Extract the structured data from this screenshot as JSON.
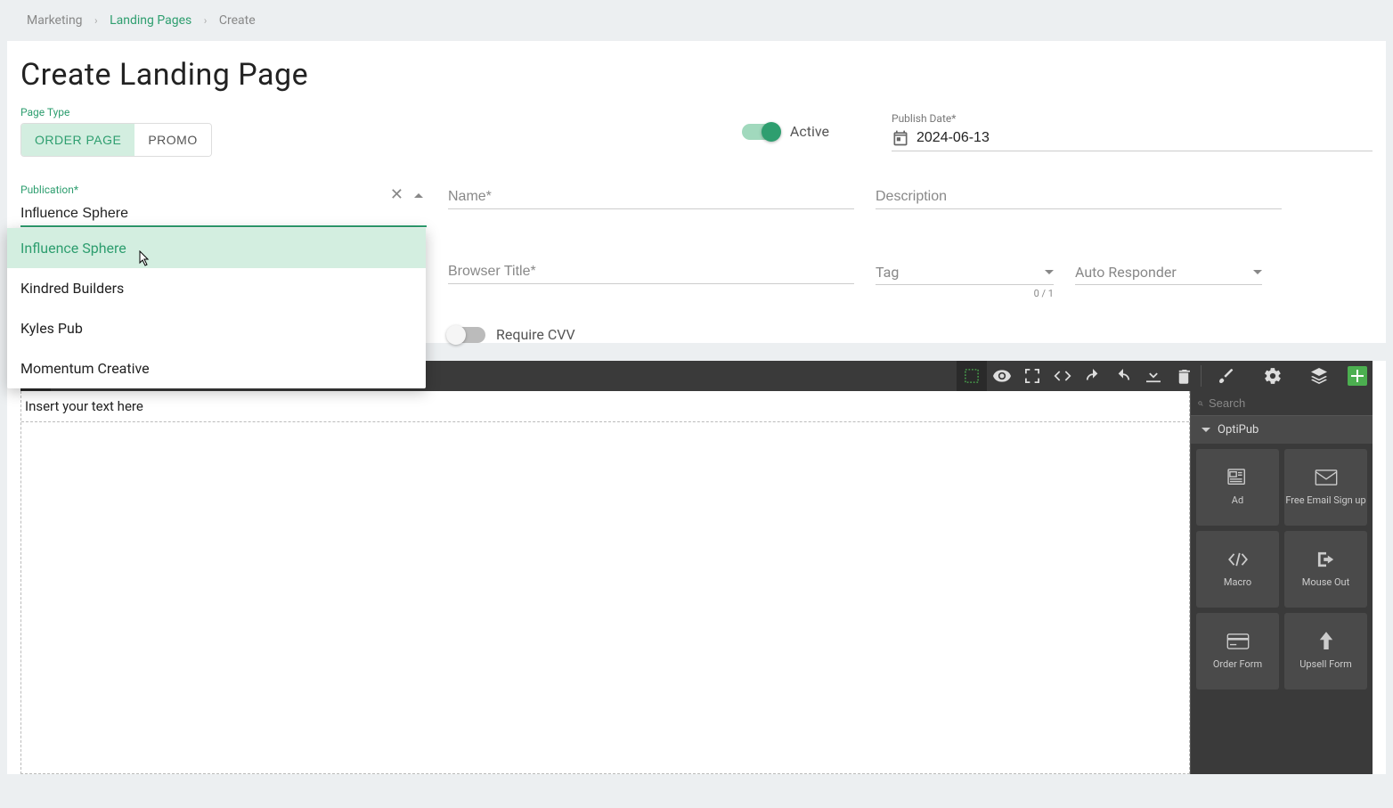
{
  "breadcrumb": {
    "l1": "Marketing",
    "l2": "Landing Pages",
    "l3": "Create"
  },
  "page_title": "Create Landing Page",
  "page_type": {
    "label": "Page Type",
    "order": "ORDER PAGE",
    "promo": "PROMO"
  },
  "active_toggle": {
    "label": "Active"
  },
  "publish_date": {
    "label": "Publish Date*",
    "value": "2024-06-13"
  },
  "publication": {
    "label": "Publication*",
    "value": "Influence Sphere",
    "options": [
      "Influence Sphere",
      "Kindred Builders",
      "Kyles Pub",
      "Momentum Creative"
    ]
  },
  "name": {
    "placeholder": "Name*"
  },
  "description": {
    "placeholder": "Description"
  },
  "browser_title": {
    "placeholder": "Browser Title*"
  },
  "tag": {
    "placeholder": "Tag",
    "counter": "0 / 1"
  },
  "auto_responder": {
    "placeholder": "Auto Responder"
  },
  "require_cvv": {
    "label": "Require CVV"
  },
  "editor": {
    "placeholder_text": "Insert your text here",
    "search_placeholder": "Search",
    "section": "OptiPub",
    "tiles": {
      "ad": "Ad",
      "email": "Free Email Sign up",
      "macro": "Macro",
      "mouseout": "Mouse Out",
      "orderform": "Order Form",
      "upsell": "Upsell Form"
    }
  }
}
